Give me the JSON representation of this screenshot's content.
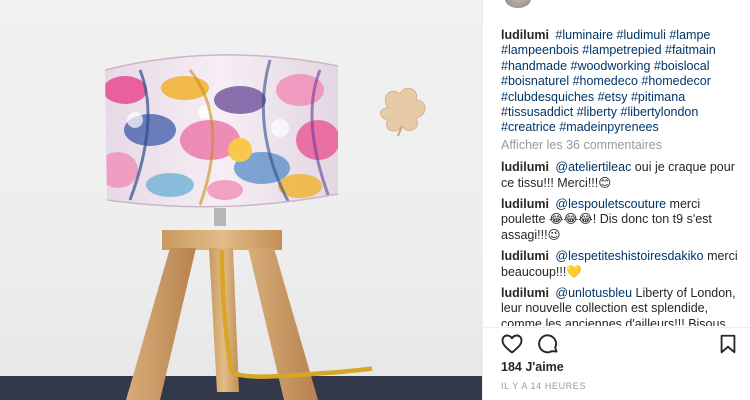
{
  "post": {
    "username": "ludilumi",
    "caption_tags": "#luminaire #ludimuli #lampe #lampeenbois #lampetrepied #faitmain #handmade #woodworking #boislocal #boisnaturel #homedeco #homedecor #clubdesquiches #etsy #pitimana #tissusaddict #liberty #libertylondon #creatrice #madeinpyrenees",
    "more_comments": "Afficher les 36 commentaires",
    "likes": "184 J'aime",
    "timestamp": "IL Y A 14 HEURES"
  },
  "comments": [
    {
      "user": "ludilumi",
      "mention": "@ateliertileac",
      "text": " oui je craque pour ce tissu!!! Merci!!!😊"
    },
    {
      "user": "ludilumi",
      "mention": "@lespouletscouture",
      "text": " merci poulette 😂😂😂! Dis donc ton t9 s'est assagi!!!😉"
    },
    {
      "user": "ludilumi",
      "mention": "@lespetiteshistoiresdakiko",
      "text": " merci beaucoup!!!💛"
    },
    {
      "user": "ludilumi",
      "mention": "@unlotusbleu",
      "text": " Liberty of London, leur nouvelle collection est splendide, comme les anciennes d'ailleurs!!! Bisous Sofi 😘"
    }
  ],
  "icons": {
    "like": "heart-icon",
    "comment": "comment-bubble-icon",
    "save": "bookmark-icon"
  },
  "colors": {
    "text": "#262626",
    "link": "#003569",
    "muted": "#999999"
  }
}
